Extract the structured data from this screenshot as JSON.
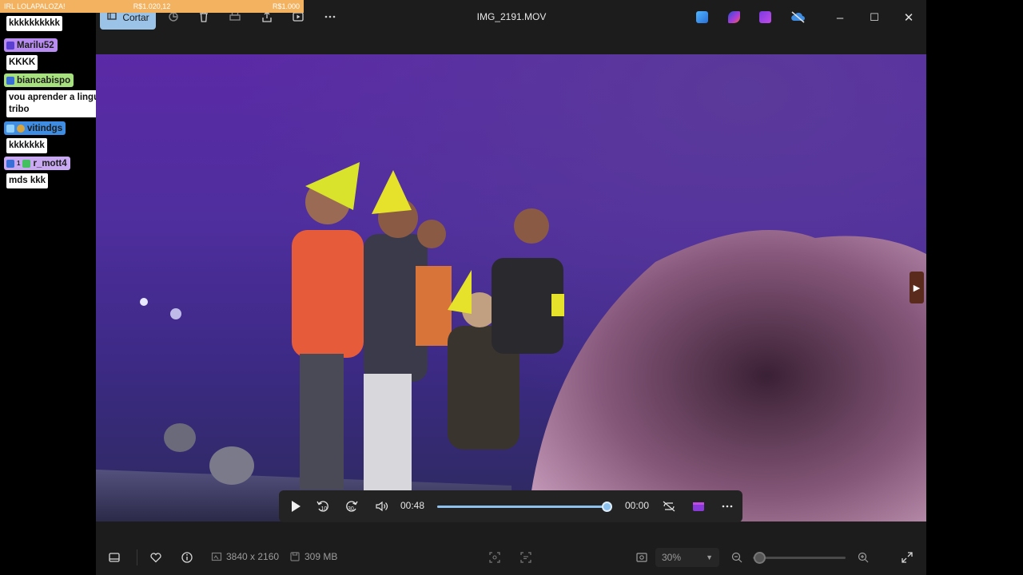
{
  "donation_bar": {
    "left": "IRL LOLAPALOZA!",
    "middle": "R$1.020,12",
    "right": "R$1.000"
  },
  "chat": [
    {
      "user": "",
      "text": "kkkkkkkkkk",
      "color": "#b98cf2"
    },
    {
      "user": "Marilu52",
      "text": "KKKK",
      "color": "#b98cf2"
    },
    {
      "user": "biancabispo",
      "text": "vou aprender a lingua da minha tribo",
      "color": "#a7e17f"
    },
    {
      "user": "vitindgs",
      "text": "kkkkkkk",
      "color": "#3f8de2"
    },
    {
      "user": "r_mott4",
      "text": "mds kkk",
      "color": "#c9a9f2",
      "badge_number": "1"
    }
  ],
  "toolbar": {
    "cut_label": "Cortar",
    "file_title": "IMG_2191.MOV",
    "icons": [
      "crop-icon",
      "magic-icon",
      "delete-icon",
      "print-icon",
      "share-icon",
      "slideshow-icon",
      "more-icon"
    ]
  },
  "title_bar_apps": [
    "photos-edit-icon",
    "clipchamp-icon",
    "video-editor-icon",
    "onedrive-off-icon"
  ],
  "window_controls": {
    "minimize": "–",
    "maximize": "☐",
    "close": "✕"
  },
  "player": {
    "current_time": "00:48",
    "remaining_time": "00:00",
    "progress": 0.99
  },
  "status": {
    "resolution": "3840 x 2160",
    "size": "309 MB",
    "zoom": "30%",
    "zoom_level": 0.07
  }
}
